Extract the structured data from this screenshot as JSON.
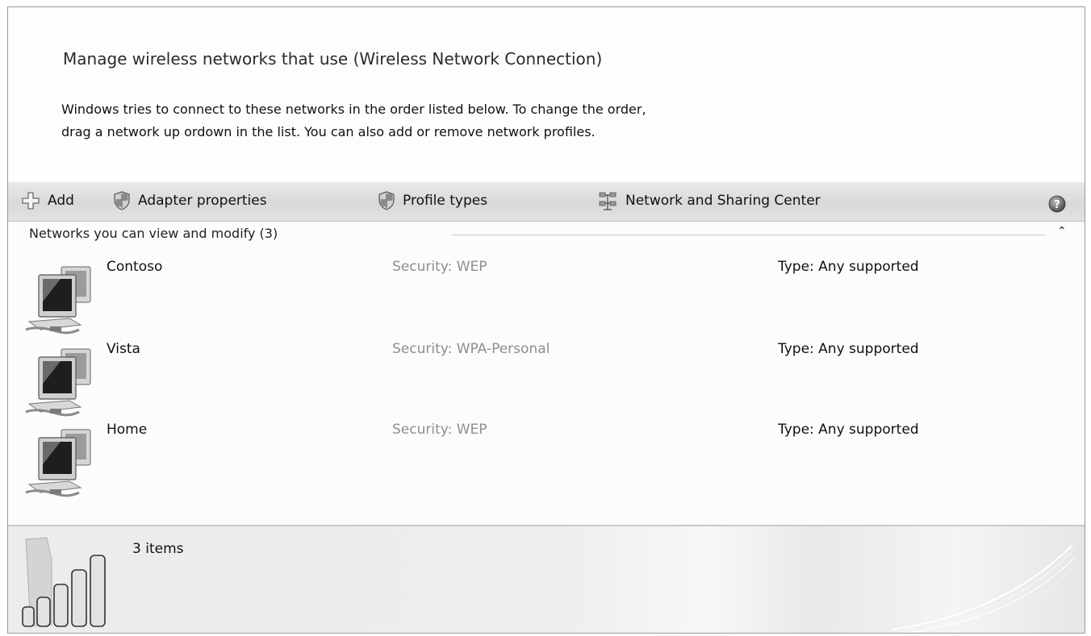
{
  "header": {
    "title": "Manage wireless networks that use (Wireless Network Connection)",
    "description": "Windows tries to connect to these networks in the order listed below. To change the order,\n drag a network up ordown in the list. You can also add or remove network profiles."
  },
  "toolbar": {
    "add_label": "Add",
    "adapter_label": "Adapter properties",
    "profile_label": "Profile types",
    "nsc_label": "Network and Sharing Center",
    "help_icon": "help-icon"
  },
  "list": {
    "group_title": "Networks you can view and modify (3)",
    "networks": [
      {
        "name": "Contoso",
        "security": "Security: WEP",
        "type": "Type: Any supported"
      },
      {
        "name": "Vista",
        "security": "Security: WPA-Personal",
        "type": "Type: Any supported"
      },
      {
        "name": "Home",
        "security": "Security: WEP",
        "type": "Type: Any supported"
      }
    ]
  },
  "details": {
    "count": "3 items"
  }
}
